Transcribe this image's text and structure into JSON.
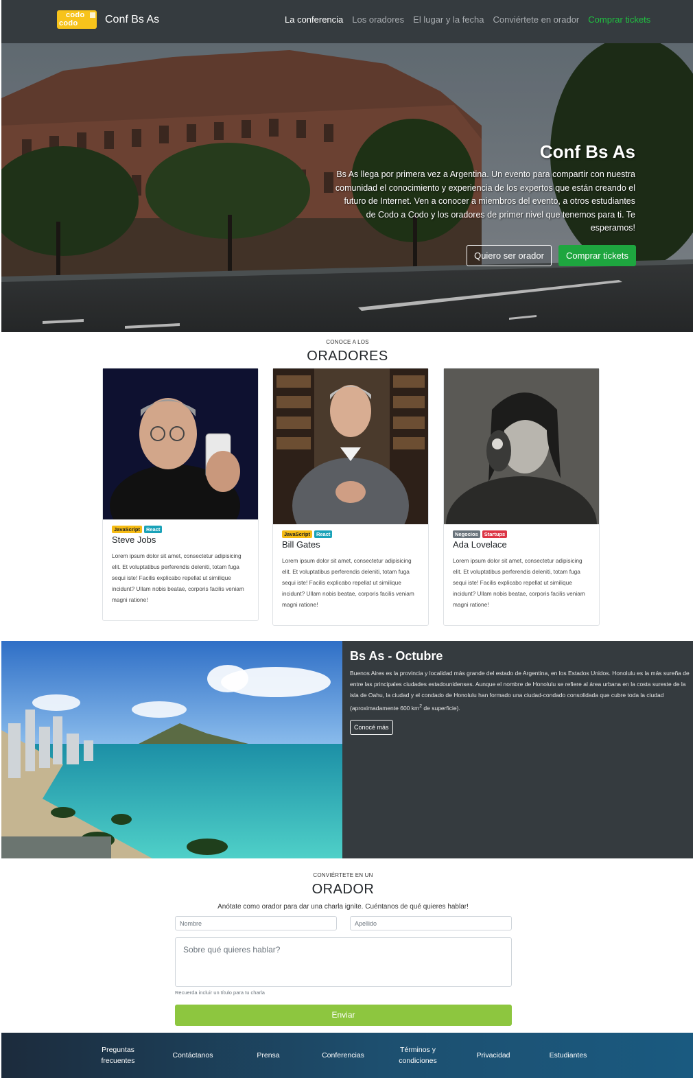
{
  "brand": {
    "logo_line1": "codo",
    "logo_line2": "codo",
    "name": "Conf Bs As"
  },
  "nav": {
    "items": [
      {
        "label": "La conferencia"
      },
      {
        "label": "Los oradores"
      },
      {
        "label": "El lugar y la fecha"
      },
      {
        "label": "Conviértete en orador"
      },
      {
        "label": "Comprar tickets"
      }
    ]
  },
  "hero": {
    "title": "Conf Bs As",
    "text": "Bs As llega por primera vez a Argentina. Un evento para compartir con nuestra comunidad el conocimiento y experiencia de los expertos que están creando el futuro de Internet. Ven a conocer a miembros del evento, a otros estudiantes de Codo a Codo y los oradores de primer nivel que tenemos para ti. Te esperamos!",
    "btn_speaker": "Quiero ser orador",
    "btn_tickets": "Comprar tickets"
  },
  "speakers": {
    "kicker": "CONOCE A LOS",
    "title": "ORADORES",
    "cards": [
      {
        "badges": [
          "JavaScript",
          "React"
        ],
        "name": "Steve Jobs",
        "text": "Lorem ipsum dolor sit amet, consectetur adipisicing elit. Et voluptatibus perferendis deleniti, totam fuga sequi iste! Facilis explicabo repellat ut similique incidunt? Ullam nobis beatae, corporis facilis veniam magni ratione!"
      },
      {
        "badges": [
          "JavaScript",
          "React"
        ],
        "name": "Bill Gates",
        "text": "Lorem ipsum dolor sit amet, consectetur adipisicing elit. Et voluptatibus perferendis deleniti, totam fuga sequi iste! Facilis explicabo repellat ut similique incidunt? Ullam nobis beatae, corporis facilis veniam magni ratione!"
      },
      {
        "badges": [
          "Negocios",
          "Startups"
        ],
        "name": "Ada Lovelace",
        "text": "Lorem ipsum dolor sit amet, consectetur adipisicing elit. Et voluptatibus perferendis deleniti, totam fuga sequi iste! Facilis explicabo repellat ut similique incidunt? Ullam nobis beatae, corporis facilis veniam magni ratione!"
      }
    ]
  },
  "location": {
    "title": "Bs As - Octubre",
    "text_before": "Buenos Aires es la provincia y localidad más grande del estado de Argentina, en los Estados Unidos. Honolulu es la más sureña de entre las principales ciudades estadounidenses. Aunque el nombre de Honolulu se refiere al área urbana en la costa sureste de la isla de Oahu, la ciudad y el condado de Honolulu han formado una ciudad-condado consolidada que cubre toda la ciudad (aproximadamente 600 km",
    "text_sup": "2",
    "text_after": " de superficie).",
    "button": "Conocé más"
  },
  "form": {
    "kicker": "CONVIÉRTETE EN UN",
    "title": "ORADOR",
    "subtitle": "Anótate como orador para dar una charla ignite. Cuéntanos de qué quieres hablar!",
    "first_name_placeholder": "Nombre",
    "last_name_placeholder": "Apellido",
    "topic_placeholder": "Sobre qué quieres hablar?",
    "help": "Recuerda incluir un título para tu charla",
    "submit": "Enviar"
  },
  "footer": {
    "items": [
      {
        "line1": "Preguntas",
        "line2": "frecuentes"
      },
      {
        "line1": "Contáctanos",
        "line2": ""
      },
      {
        "line1": "Prensa",
        "line2": ""
      },
      {
        "line1": "Conferencias",
        "line2": ""
      },
      {
        "line1": "Términos y",
        "line2": "condiciones"
      },
      {
        "line1": "Privacidad",
        "line2": ""
      },
      {
        "line1": "Estudiantes",
        "line2": ""
      }
    ]
  },
  "colors": {
    "navbar": "#353b3f",
    "accent_green": "#1ea63f",
    "send_button": "#8dc63f",
    "badge_yellow": "#f5bb14",
    "badge_teal": "#1aa2b8",
    "badge_gray": "#6a747c",
    "badge_red": "#dc3545"
  }
}
